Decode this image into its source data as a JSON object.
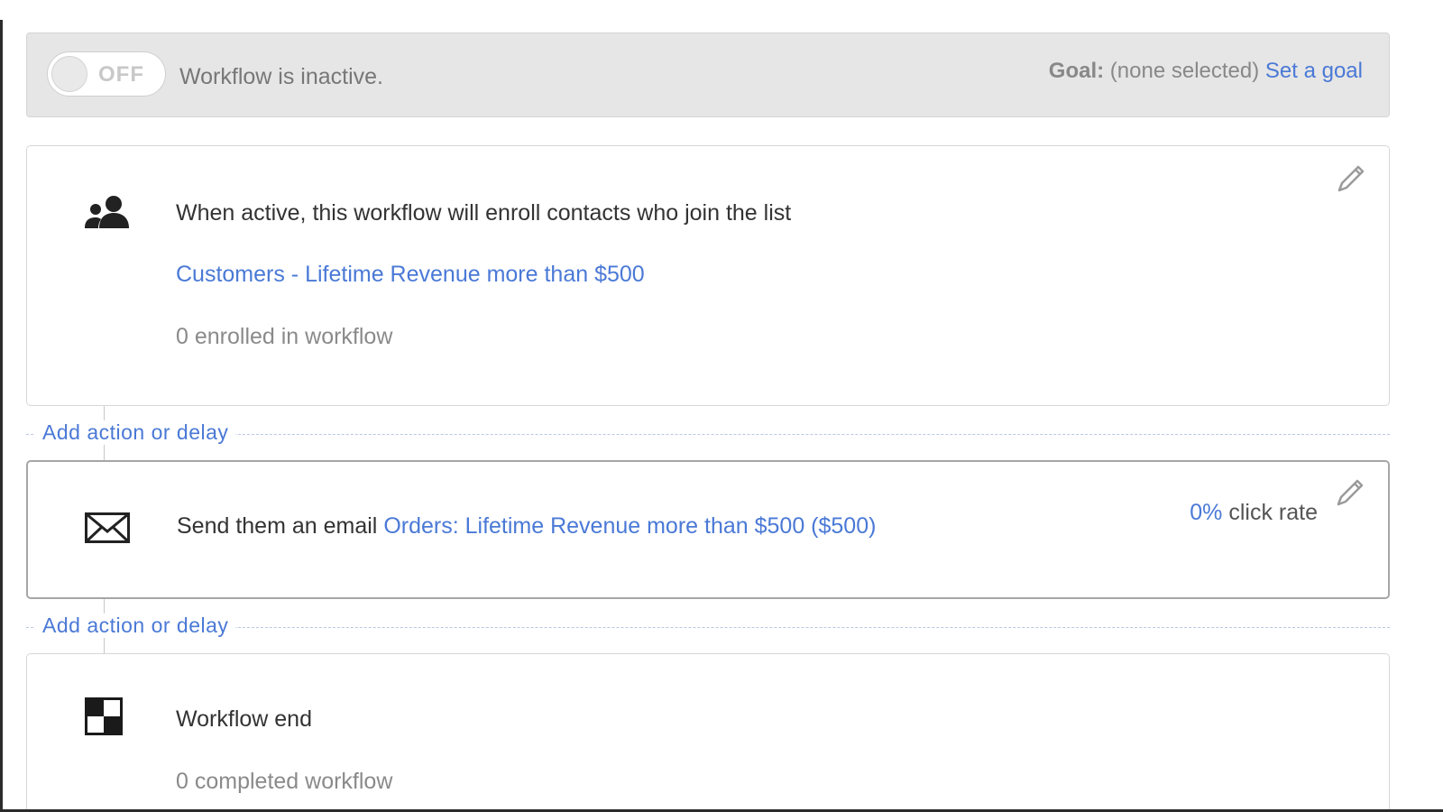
{
  "status_bar": {
    "toggle_label": "OFF",
    "status_text": "Workflow is inactive.",
    "goal_label": "Goal:",
    "goal_value": "(none selected)",
    "goal_link": "Set a goal"
  },
  "enroll_step": {
    "icon": "contacts-icon",
    "title": "When active, this workflow will enroll contacts who join the list",
    "list_link": "Customers - Lifetime Revenue more than $500",
    "enrolled_text": "0 enrolled in workflow"
  },
  "add_action_label": "Add action or delay",
  "email_step": {
    "icon": "envelope-icon",
    "prefix": "Send them an email",
    "email_link": "Orders: Lifetime Revenue more than $500 ($500)",
    "click_rate_value": "0%",
    "click_rate_label": "click rate"
  },
  "end_step": {
    "icon": "checkered-flag-icon",
    "title": "Workflow end",
    "completed_text": "0 completed workflow"
  },
  "colors": {
    "link": "#4a79d6",
    "status_bar_bg": "#e6e6e6",
    "text": "#333333",
    "muted": "#8a8a8a"
  }
}
